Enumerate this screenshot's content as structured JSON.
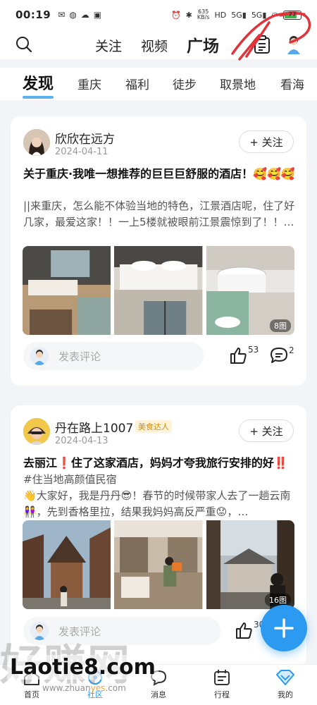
{
  "status_bar": {
    "time": "00:19",
    "net_speed_value": "635",
    "net_speed_unit": "KB/s",
    "battery": "77"
  },
  "top_nav": {
    "tabs": [
      "关注",
      "视频",
      "广场"
    ],
    "active_tab": "广场"
  },
  "categories": {
    "items": [
      "发现",
      "重庆",
      "福利",
      "徒步",
      "取景地",
      "看海"
    ],
    "active": "发现"
  },
  "posts": [
    {
      "author": "欣欣在远方",
      "date": "2024-04-11",
      "follow_label": "+ 关注",
      "title": "关于重庆·我唯一想推荐的巨巨巨舒服的酒店！🥰🥰🥰",
      "body": "||来重庆，怎么能不体验当地的特色，江景酒店呢，住了好几家，最爱这家！！一上5楼就被眼前江景震惊到了！！…",
      "photo_count": "8图",
      "comment_placeholder": "发表评论",
      "likes": "53",
      "comments": "2"
    },
    {
      "author": "丹在路上1007",
      "badge": "美食达人",
      "date": "2024-04-13",
      "follow_label": "+ 关注",
      "title": "去丽江❗住了这家酒店，妈妈才夸我旅行安排的好‼️",
      "tag": "#住当地高颜值民宿",
      "body": "👋大家好，我是丹丹😎！春节的时候带家人去了一趟云南👭，先到香格里拉，结果我妈妈高反严重😟，…",
      "photo_count": "16图",
      "comment_placeholder": "发表评论",
      "likes": "30"
    }
  ],
  "bottom_nav": {
    "items": [
      "首页",
      "社区",
      "消息",
      "行程",
      "我的"
    ],
    "active": "社区"
  },
  "watermark": {
    "big": "好赚网",
    "mid": "Laotie8.com",
    "small_prefix": "www.zhuan",
    "small_highlight": "yes",
    "small_suffix": ".com"
  },
  "colors": {
    "accent": "#2b9af0",
    "tab_indicator": "#5ab3ef",
    "badge_text": "#d08a10",
    "scribble": "#e0343a"
  }
}
